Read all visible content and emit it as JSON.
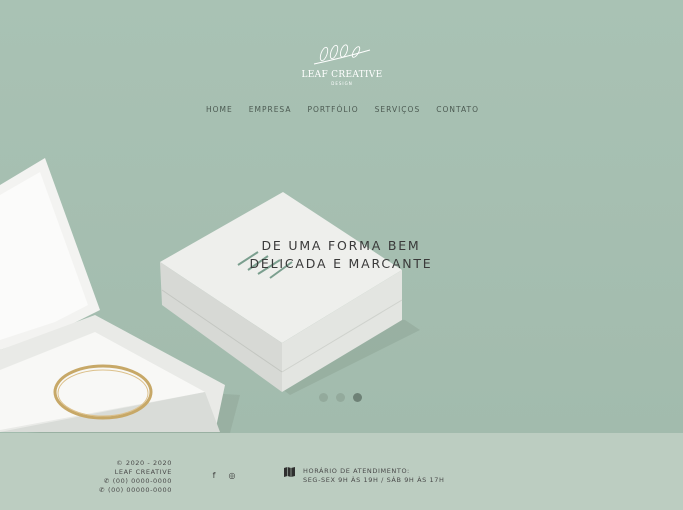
{
  "brand": {
    "name": "LEAF CREATIVE",
    "sub": "DESIGN"
  },
  "nav": [
    {
      "label": "HOME"
    },
    {
      "label": "EMPRESA"
    },
    {
      "label": "PORTFÓLIO"
    },
    {
      "label": "SERVIÇOS"
    },
    {
      "label": "CONTATO"
    }
  ],
  "hero": {
    "tagline_line1": "DE UMA FORMA BEM",
    "tagline_line2": "DELICADA E MARCANTE",
    "slides_total": 3,
    "active_slide": 3
  },
  "footer": {
    "copyright": "© 2020 - 2020",
    "company": "LEAF CREATIVE",
    "phone": "(00) 0000-0000",
    "whatsapp": "(00) 00000-0000",
    "social": [
      {
        "icon": "facebook-icon",
        "glyph": "f"
      },
      {
        "icon": "instagram-icon",
        "glyph": "◎"
      }
    ],
    "hours_title": "HORÁRIO DE ATENDIMENTO:",
    "hours_text": "SEG-SEX 9H ÀS 19H / SÁB 9H ÀS 17H"
  },
  "colors": {
    "background": "#a3bcae",
    "footer": "#bccdc1",
    "text": "#4a4a4a"
  }
}
